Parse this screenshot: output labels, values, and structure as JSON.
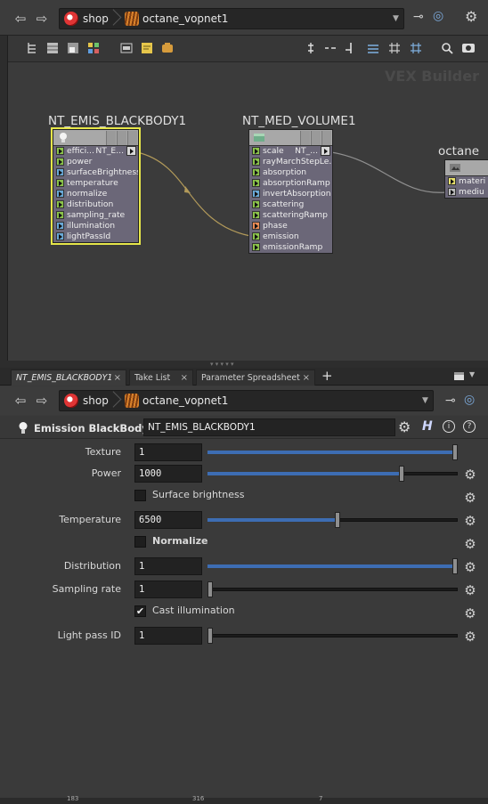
{
  "top_path": {
    "root": "shop",
    "current": "octane_vopnet1"
  },
  "network": {
    "pane_label": "VEX Builder",
    "nodes": [
      {
        "title": "NT_EMIS_BLACKBODY1",
        "selected": true,
        "inputs": [
          {
            "label": "effici...",
            "pin": "green",
            "out": "NT_E..."
          },
          {
            "label": "power",
            "pin": "green"
          },
          {
            "label": "surfaceBrightness",
            "pin": "blue"
          },
          {
            "label": "temperature",
            "pin": "green"
          },
          {
            "label": "normalize",
            "pin": "blue"
          },
          {
            "label": "distribution",
            "pin": "green"
          },
          {
            "label": "sampling_rate",
            "pin": "green"
          },
          {
            "label": "illumination",
            "pin": "blue"
          },
          {
            "label": "lightPassId",
            "pin": "blue"
          }
        ]
      },
      {
        "title": "NT_MED_VOLUME1",
        "selected": false,
        "inputs": [
          {
            "label": "scale",
            "pin": "green",
            "out": "NT_..."
          },
          {
            "label": "rayMarchStepLe...",
            "pin": "green"
          },
          {
            "label": "absorption",
            "pin": "green"
          },
          {
            "label": "absorptionRamp",
            "pin": "green"
          },
          {
            "label": "invertAbsorption",
            "pin": "blue"
          },
          {
            "label": "scattering",
            "pin": "green"
          },
          {
            "label": "scatteringRamp",
            "pin": "green"
          },
          {
            "label": "phase",
            "pin": "orange"
          },
          {
            "label": "emission",
            "pin": "green"
          },
          {
            "label": "emissionRamp",
            "pin": "green"
          }
        ]
      },
      {
        "title": "octane",
        "selected": false,
        "inputs": [
          {
            "label": "materi",
            "pin": "yellow"
          },
          {
            "label": "mediu",
            "pin": "gray"
          }
        ]
      }
    ]
  },
  "tabs": [
    {
      "label": "NT_EMIS_BLACKBODY1",
      "active": true
    },
    {
      "label": "Take List",
      "active": false
    },
    {
      "label": "Parameter Spreadsheet",
      "active": false
    }
  ],
  "tab_add": "+",
  "lower_path": {
    "root": "shop",
    "current": "octane_vopnet1"
  },
  "param_header": {
    "node_type": "Emission BlackBody",
    "node_name": "NT_EMIS_BLACKBODY1",
    "h_label": "H"
  },
  "params": {
    "texture": {
      "label": "Texture",
      "value": "1",
      "fraction": 1.0
    },
    "power": {
      "label": "Power",
      "value": "1000",
      "fraction": 0.78
    },
    "surface_brightness": {
      "label": "Surface brightness",
      "checked": false
    },
    "temperature": {
      "label": "Temperature",
      "value": "6500",
      "fraction": 0.52
    },
    "normalize": {
      "label": "Normalize",
      "checked": false
    },
    "distribution": {
      "label": "Distribution",
      "value": "1",
      "fraction": 1.0
    },
    "sampling_rate": {
      "label": "Sampling rate",
      "value": "1",
      "fraction": 0.0
    },
    "cast_illumination": {
      "label": "Cast illumination",
      "checked": true,
      "mark": "✔"
    },
    "light_pass_id": {
      "label": "Light pass ID",
      "value": "1",
      "fraction": 0.0
    }
  },
  "status": {
    "a": "183",
    "b": "316",
    "c": "7"
  },
  "colors": {
    "accent": "#3d6db3",
    "selection": "#e6e64a",
    "wire": "#b29a5a"
  }
}
